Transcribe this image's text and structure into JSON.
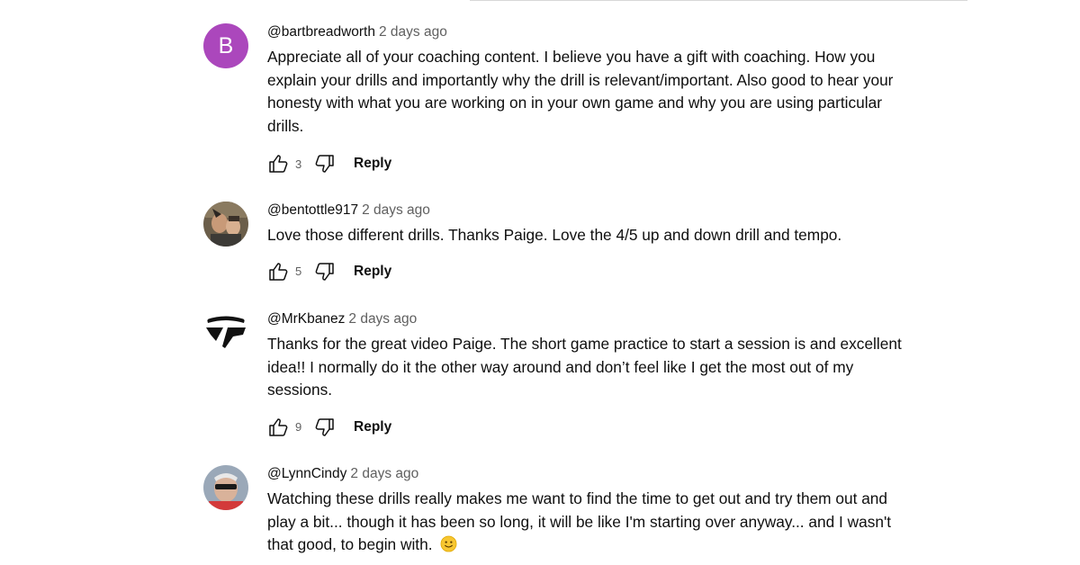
{
  "comments": [
    {
      "author": "@bartbreadworth",
      "time": "2 days ago",
      "text": "Appreciate all of your coaching content. I believe you have a gift with coaching. How you explain your drills and importantly why the drill is relevant/important. Also good to hear your honesty with what you are working on in your own game and why you are using particular drills.",
      "likes": "3",
      "reply_label": "Reply",
      "avatar_letter": "B",
      "avatar_color": "#ab47bc"
    },
    {
      "author": "@bentottle917",
      "time": "2 days ago",
      "text": "Love those different drills. Thanks Paige. Love the 4/5 up and down drill and tempo.",
      "likes": "5",
      "reply_label": "Reply"
    },
    {
      "author": "@MrKbanez",
      "time": "2 days ago",
      "text": "Thanks for the great video Paige. The short game practice to start a session is and excellent idea!! I normally do it the other way around and don’t feel like I get the most out of my sessions.",
      "likes": "9",
      "reply_label": "Reply"
    },
    {
      "author": "@LynnCindy",
      "time": "2 days ago",
      "text": "Watching these drills really makes me want to find the time to get out and try them out and play a bit... though it has been so long, it will be like I'm starting over anyway... and I wasn't that good, to begin with.",
      "emoji": "slightly-smiling-face"
    }
  ],
  "colors": {
    "text_primary": "#0f0f0f",
    "text_secondary": "#606060",
    "avatar_purple": "#ab47bc",
    "emoji_yellow": "#f7c631"
  }
}
